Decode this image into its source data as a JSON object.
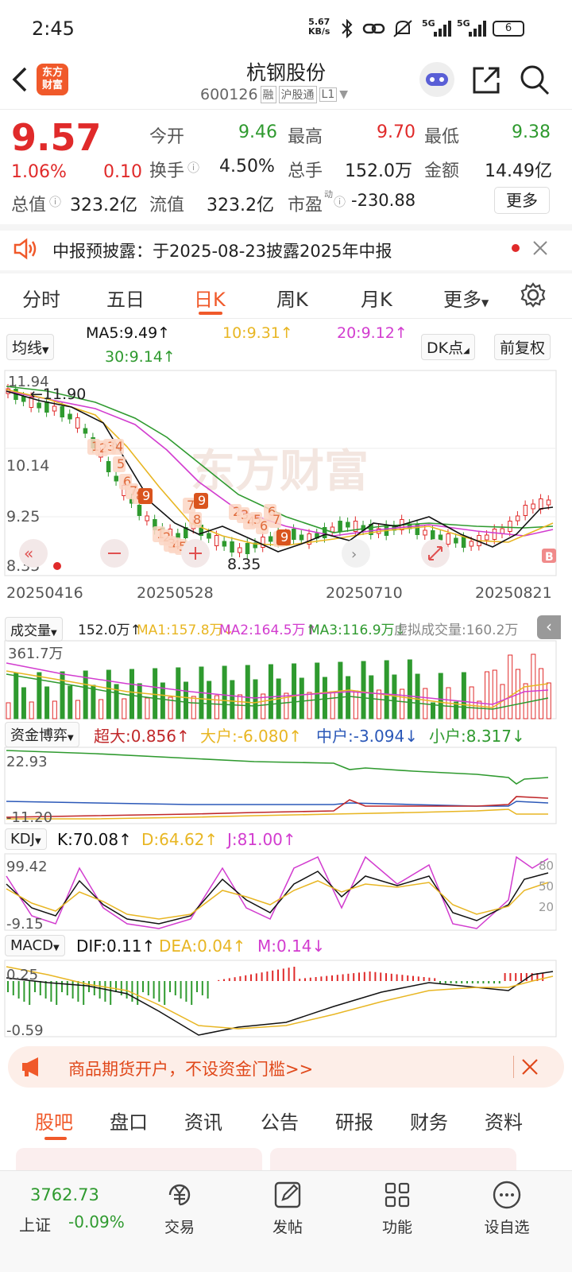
{
  "status_bar": {
    "time": "2:45",
    "net_speed_top": "5.67",
    "net_speed_bottom": "KB/s",
    "battery": "6",
    "signal1": "5G",
    "signal2": "5G"
  },
  "header": {
    "title": "杭钢股份",
    "code": "600126",
    "tag1": "融",
    "tag2": "沪股通",
    "tag3": "L1",
    "logo_line1": "东方",
    "logo_line2": "财富"
  },
  "quote": {
    "price": "9.57",
    "pct": "1.06%",
    "change": "0.10",
    "open_label": "今开",
    "open": "9.46",
    "high_label": "最高",
    "high": "9.70",
    "low_label": "最低",
    "low": "9.38",
    "turnover_label": "换手",
    "turnover": "4.50%",
    "volume_label": "总手",
    "volume": "152.0万",
    "amount_label": "金额",
    "amount": "14.49亿",
    "mcap_label": "总值",
    "mcap": "323.2亿",
    "float_label": "流值",
    "float": "323.2亿",
    "pe_label": "市盈",
    "pe_sup": "动",
    "pe": "-230.88",
    "more": "更多"
  },
  "notice": {
    "text": "中报预披露：于2025-08-23披露2025年中报"
  },
  "tabs": [
    "分时",
    "五日",
    "日K",
    "周K",
    "月K",
    "更多"
  ],
  "kline": {
    "ma_label": "均线",
    "ma5": "MA5:9.49↑",
    "ma10": "10:9.31↑",
    "ma20": "20:9.12↑",
    "ma30": "30:9.14↑",
    "dk": "DK点",
    "adjust": "前复权",
    "y_top": "11.94",
    "y1": "10.14",
    "y2": "9.25",
    "y_bottom": "8.35",
    "max_label": "←11.90",
    "min_label": "8.35",
    "dates": [
      "20250416",
      "20250528",
      "20250710",
      "20250821"
    ],
    "watermark": "东方财富",
    "seq_marks": [
      "1",
      "2",
      "3",
      "4",
      "5",
      "6",
      "7",
      "8",
      "9",
      "7",
      "8",
      "9",
      "2",
      "3",
      "4",
      "5",
      "6",
      "1",
      "2",
      "3",
      "4",
      "5",
      "6",
      "7",
      "8",
      "9"
    ]
  },
  "volume": {
    "label": "成交量",
    "v": "152.0万↑",
    "ma1": "MA1:157.8万↓",
    "ma2": "MA2:164.5万↑",
    "ma3": "MA3:116.9万↓",
    "virtual": "虚拟成交量:160.2万",
    "y_top": "361.7万"
  },
  "capital": {
    "label": "资金博弈",
    "super": "超大:0.856↑",
    "big": "大户:-6.080↑",
    "mid": "中户:-3.094↓",
    "small": "小户:8.317↓",
    "y_top": "22.93",
    "y_bottom": "-11.20"
  },
  "kdj": {
    "label": "KDJ",
    "k": "K:70.08↑",
    "d": "D:64.62↑",
    "j": "J:81.00↑",
    "y_top": "99.42",
    "y_bottom": "-9.15",
    "r80": "80",
    "r50": "50",
    "r20": "20"
  },
  "macd": {
    "label": "MACD",
    "dif": "DIF:0.11↑",
    "dea": "DEA:0.04↑",
    "m": "M:0.14↓",
    "y_top": "0.25",
    "y_bottom": "-0.59"
  },
  "ad": {
    "text": "商品期货开户，不设资金门槛>>"
  },
  "bottom_tabs": [
    "股吧",
    "盘口",
    "资讯",
    "公告",
    "研报",
    "财务",
    "资料"
  ],
  "nav": {
    "index_value": "3762.73",
    "index_name": "上证",
    "index_pct": "-0.09%",
    "items": [
      "交易",
      "发帖",
      "功能",
      "设自选"
    ]
  },
  "colors": {
    "up": "#e02a2a",
    "down": "#2f9a2f",
    "accent": "#f0592a",
    "ma5": "#111111",
    "ma10": "#e8b623",
    "ma20": "#d23ccf",
    "ma30": "#2f9a2f"
  }
}
